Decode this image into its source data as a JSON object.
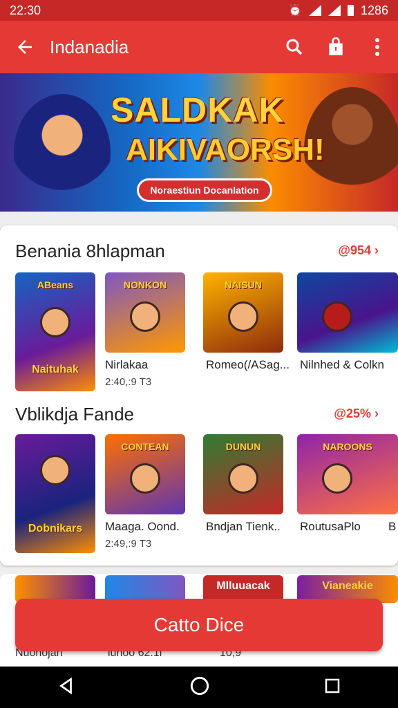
{
  "status": {
    "time": "22:30",
    "battery_text": "1286"
  },
  "appbar": {
    "title": "Indanadia"
  },
  "banner": {
    "line1": "SALDKAK",
    "line2": "AIKIVAORSH!",
    "chip": "Noraestiun Docanlation"
  },
  "section1": {
    "title": "Benania 8hlapman",
    "more": "@954 ›",
    "tiles": [
      {
        "badge": "ABeans",
        "label_art": "Naituhak",
        "name": "Nirlakaa",
        "sub": "2:40,:9 T3"
      },
      {
        "badge": "NONKON",
        "name": "Romeo(/ASag..."
      },
      {
        "badge": "NAISUN",
        "name": "Nilnhed & Colkn"
      },
      {
        "badge": "",
        "name": ""
      }
    ]
  },
  "section2": {
    "title": "Vblikdja Fande",
    "more": "@25% ›",
    "tiles": [
      {
        "badge": "Dobnikars",
        "name": "Maaga. Oond.",
        "sub": "2:49,:9 T3"
      },
      {
        "badge": "CONTEAN",
        "name": "Bndjan Tienk.."
      },
      {
        "badge": "DUNUN",
        "name": "RoutusaPlo"
      },
      {
        "badge": "NAROONS",
        "name": "B"
      }
    ]
  },
  "section3": {
    "tiles": [
      "",
      "",
      "Mlluuacak",
      "Vianeakie"
    ]
  },
  "cta": {
    "label": "Catto Dice"
  },
  "bottom_row": [
    "Nuohojan",
    "lunoo 62.1l",
    "10,9"
  ],
  "colors": {
    "accent": "#e53935",
    "status": "#c62828"
  }
}
